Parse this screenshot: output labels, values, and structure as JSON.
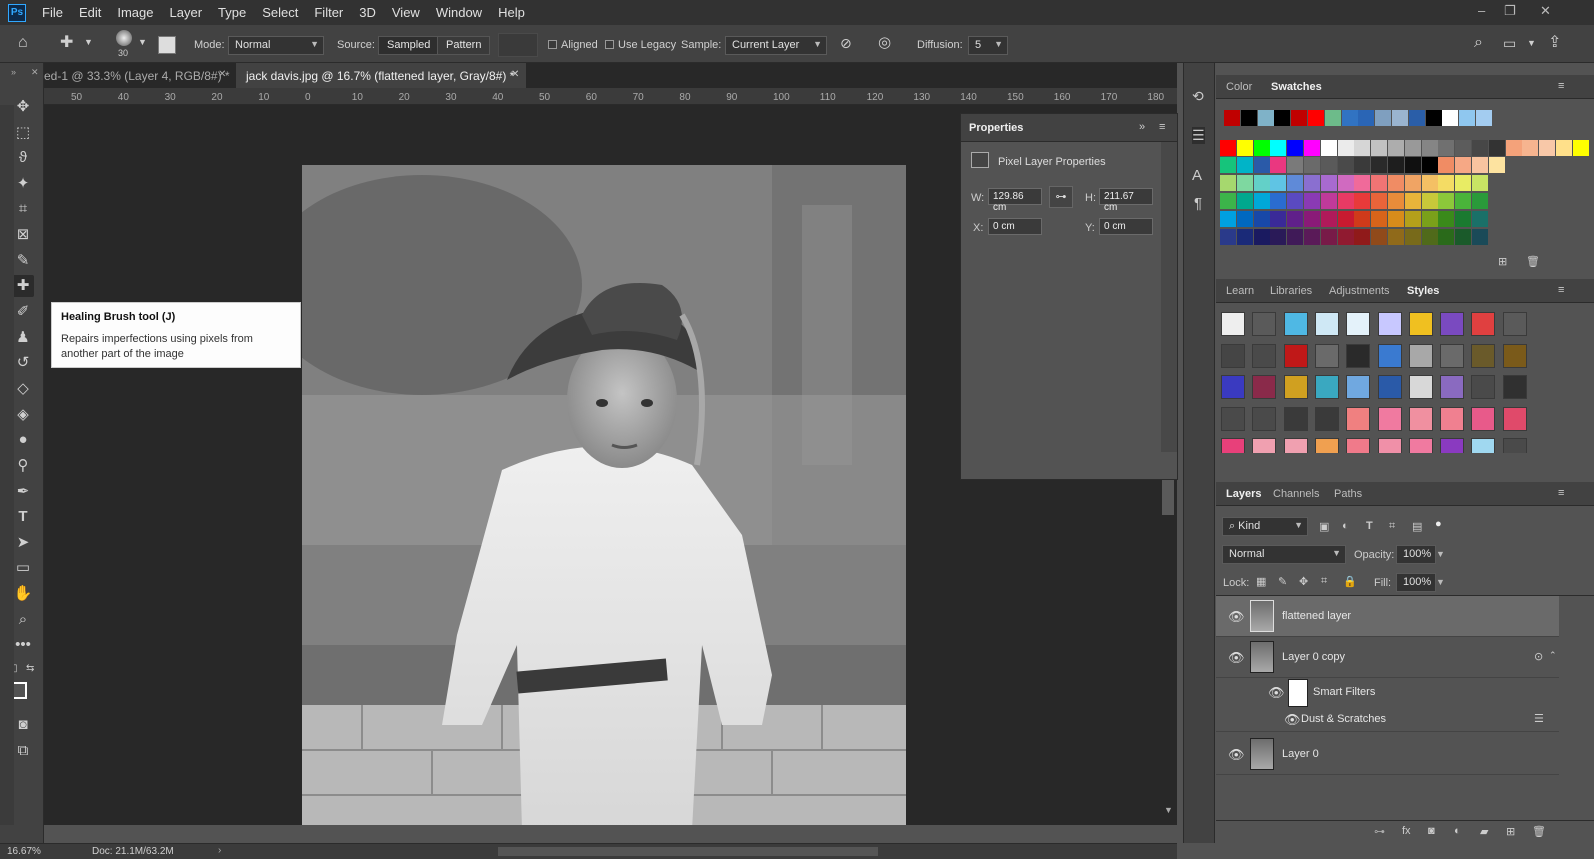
{
  "app": {
    "logo": "Ps"
  },
  "menu": [
    "File",
    "Edit",
    "Image",
    "Layer",
    "Type",
    "Select",
    "Filter",
    "3D",
    "View",
    "Window",
    "Help"
  ],
  "window_controls": {
    "minimize": "–",
    "restore": "❐",
    "close": "✕"
  },
  "options_bar": {
    "brush_size": "30",
    "mode_label": "Mode:",
    "mode_value": "Normal",
    "source_label": "Source:",
    "source_sampled": "Sampled",
    "source_pattern": "Pattern",
    "aligned_label": "Aligned",
    "use_legacy_label": "Use Legacy",
    "sample_label": "Sample:",
    "sample_value": "Current Layer",
    "diffusion_label": "Diffusion:",
    "diffusion_value": "5"
  },
  "tabs": [
    {
      "label": "ed-1 @ 33.3% (Layer 4, RGB/8#) *",
      "active": false
    },
    {
      "label": "jack davis.jpg @ 16.7% (flattened layer, Gray/8#) *",
      "active": true
    }
  ],
  "ruler_ticks": [
    "50",
    "40",
    "30",
    "20",
    "10",
    "0",
    "10",
    "20",
    "30",
    "40",
    "50",
    "60",
    "70",
    "80",
    "90",
    "100",
    "110",
    "120",
    "130",
    "140",
    "150",
    "160",
    "170",
    "180"
  ],
  "tooltip": {
    "title": "Healing Brush tool (J)",
    "body": "Repairs imperfections using pixels from another part of the image"
  },
  "properties": {
    "title": "Properties",
    "subtitle": "Pixel Layer Properties",
    "w_label": "W:",
    "w_value": "129.86 cm",
    "h_label": "H:",
    "h_value": "211.67 cm",
    "x_label": "X:",
    "x_value": "0 cm",
    "y_label": "Y:",
    "y_value": "0 cm"
  },
  "color_panel": {
    "tabs": [
      "Color",
      "Swatches"
    ],
    "active": "Swatches"
  },
  "styles_panel": {
    "tabs": [
      "Learn",
      "Libraries",
      "Adjustments",
      "Styles"
    ],
    "active": "Styles"
  },
  "layers_panel": {
    "tabs": [
      "Layers",
      "Channels",
      "Paths"
    ],
    "active": "Layers",
    "filter_kind": "Kind",
    "blend_mode": "Normal",
    "opacity_label": "Opacity:",
    "opacity_value": "100%",
    "lock_label": "Lock:",
    "fill_label": "Fill:",
    "fill_value": "100%",
    "layers": [
      {
        "name": "flattened layer",
        "selected": true
      },
      {
        "name": "Layer 0 copy",
        "selected": false
      },
      {
        "name": "Smart Filters",
        "selected": false
      },
      {
        "name": "Dust & Scratches",
        "selected": false
      },
      {
        "name": "Layer 0",
        "selected": false
      }
    ]
  },
  "status": {
    "zoom": "16.67%",
    "doc": "Doc: 21.1M/63.2M"
  },
  "colors": {
    "swatch_recent": [
      "#c00000",
      "#000000",
      "#7fb2c8",
      "#000000",
      "#c00000",
      "#ff0000",
      "#6dbb8a",
      "#3173c2",
      "#2a65b5",
      "#7f9fbf",
      "#9ab4cf",
      "#2a5ea8",
      "#000000",
      "#ffffff",
      "#8fc7ef",
      "#a3ccf0"
    ],
    "swatch_row1": [
      "#ff0000",
      "#ffff00",
      "#00ff00",
      "#00ffff",
      "#0000ff",
      "#ff00ff",
      "#ffffff",
      "#ebebeb",
      "#d6d6d6",
      "#c2c2c2",
      "#adadad",
      "#999999",
      "#858585",
      "#707070",
      "#5c5c5c",
      "#474747",
      "#333333",
      "#f4a27a",
      "#f6b48f",
      "#f8c8a8",
      "#ffe08a",
      "#ffff00"
    ],
    "swatch_row2": [
      "#16c47b",
      "#00b4c8",
      "#2a5aa8",
      "#ea3780",
      "#7a7a7a",
      "#6a6a6a",
      "#5a5a5a",
      "#4a4a4a",
      "#3a3a3a",
      "#2a2a2a",
      "#1e1e1e",
      "#101010",
      "#000000",
      "#f08c64",
      "#f6a885",
      "#f8c4a0",
      "#fde3a0"
    ],
    "swatch_row3": [
      "#a6d86e",
      "#7ed8a0",
      "#63d0c8",
      "#5fc4e4",
      "#5f8ad8",
      "#8a6fd0",
      "#a86ad0",
      "#d06ac0",
      "#f06a9a",
      "#f07474",
      "#f08c64",
      "#f0a464",
      "#f4c064",
      "#f4dc64",
      "#e8ec64",
      "#c8e464"
    ],
    "swatch_row4": [
      "#3cb44a",
      "#00a88e",
      "#00a8d8",
      "#2a6cd0",
      "#5a4ac0",
      "#8a3ab4",
      "#c03a9a",
      "#e83a64",
      "#e83a3a",
      "#e8643a",
      "#e88c3a",
      "#e8b43a",
      "#c8c83a",
      "#8cc83a",
      "#4ab43a",
      "#2a9a3a"
    ],
    "swatch_row5": [
      "#00a0e0",
      "#0068c0",
      "#1848a8",
      "#3a2a98",
      "#60208a",
      "#8a1a78",
      "#b01a5a",
      "#c81a30",
      "#d03a1a",
      "#d8641a",
      "#d88c1a",
      "#b4a01a",
      "#7aa01a",
      "#3a8a1a",
      "#1a7a30",
      "#1a7068"
    ],
    "swatch_row6": [
      "#2a3a8a",
      "#1a2a78",
      "#1a1a60",
      "#2a1a58",
      "#401a58",
      "#5a1a58",
      "#781a48",
      "#901a30",
      "#901a1a",
      "#904a1a",
      "#906a1a",
      "#786a1a",
      "#506a1a",
      "#2a6a1a",
      "#1a5a2a",
      "#1a4a58"
    ]
  }
}
